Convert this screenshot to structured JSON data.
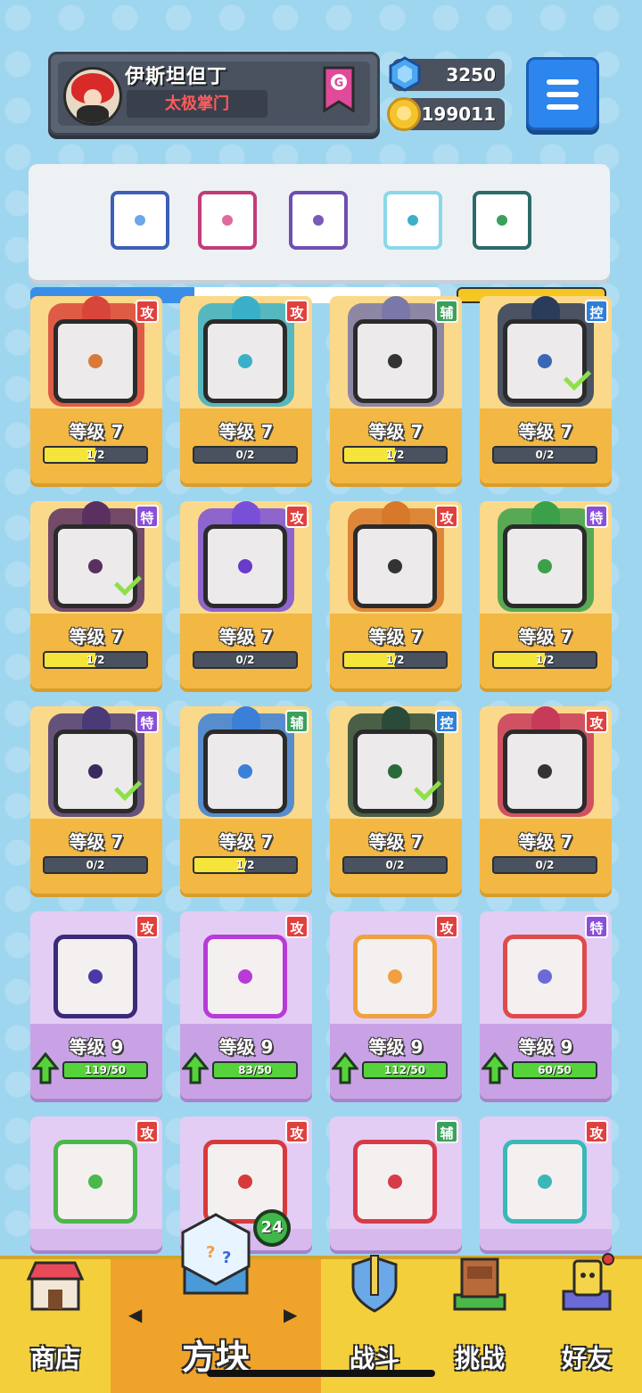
{
  "profile": {
    "name": "伊斯坦但丁",
    "title": "太极掌门",
    "rank_letter": "G"
  },
  "currency": {
    "gems": "3250",
    "coins": "199011"
  },
  "deck": [
    {
      "color": "#3d5fb8",
      "pip": "#6aa8e8"
    },
    {
      "color": "#c23c7a",
      "pip": "#e06a9a"
    },
    {
      "color": "#6e4fb0",
      "pip": "#7a5ab8"
    },
    {
      "color": "#8ad8e8",
      "pip": "#3cb0c8"
    },
    {
      "color": "#2d6a6a",
      "pip": "#3aa05a"
    }
  ],
  "cards": [
    {
      "tag": "攻",
      "tagType": "atk",
      "level": "等级 7",
      "progress": "1/2",
      "fill": 0.5,
      "theme": "#d8453a",
      "pip": "#d87a3a",
      "check": false,
      "kind": "gold"
    },
    {
      "tag": "攻",
      "tagType": "atk",
      "level": "等级 7",
      "progress": "0/2",
      "fill": 0,
      "theme": "#3ab0c8",
      "pip": "#3ab0c8",
      "check": false,
      "kind": "gold"
    },
    {
      "tag": "辅",
      "tagType": "sup",
      "level": "等级 7",
      "progress": "1/2",
      "fill": 0.5,
      "theme": "#7a78a8",
      "pip": "#333333",
      "check": false,
      "kind": "gold"
    },
    {
      "tag": "控",
      "tagType": "ctl",
      "level": "等级 7",
      "progress": "0/2",
      "fill": 0,
      "theme": "#2b3b5a",
      "pip": "#3a66b8",
      "check": true,
      "kind": "gold"
    },
    {
      "tag": "特",
      "tagType": "spc",
      "level": "等级 7",
      "progress": "1/2",
      "fill": 0.5,
      "theme": "#5a3060",
      "pip": "#5a3060",
      "check": true,
      "kind": "gold"
    },
    {
      "tag": "攻",
      "tagType": "atk",
      "level": "等级 7",
      "progress": "0/2",
      "fill": 0,
      "theme": "#7a4fd8",
      "pip": "#6a3ac8",
      "check": false,
      "kind": "gold"
    },
    {
      "tag": "攻",
      "tagType": "atk",
      "level": "等级 7",
      "progress": "1/2",
      "fill": 0.5,
      "theme": "#d8782a",
      "pip": "#333333",
      "check": false,
      "kind": "gold"
    },
    {
      "tag": "特",
      "tagType": "spc",
      "level": "等级 7",
      "progress": "1/2",
      "fill": 0.5,
      "theme": "#3aa04a",
      "pip": "#3aa04a",
      "check": false,
      "kind": "gold"
    },
    {
      "tag": "特",
      "tagType": "spc",
      "level": "等级 7",
      "progress": "0/2",
      "fill": 0,
      "theme": "#4a3a78",
      "pip": "#3a2a60",
      "check": true,
      "kind": "gold"
    },
    {
      "tag": "辅",
      "tagType": "sup",
      "level": "等级 7",
      "progress": "1/2",
      "fill": 0.5,
      "theme": "#3a7fd8",
      "pip": "#3a7fd8",
      "check": false,
      "kind": "gold"
    },
    {
      "tag": "控",
      "tagType": "ctl",
      "level": "等级 7",
      "progress": "0/2",
      "fill": 0,
      "theme": "#2a4a3a",
      "pip": "#2a6a3a",
      "check": true,
      "kind": "gold"
    },
    {
      "tag": "攻",
      "tagType": "atk",
      "level": "等级 7",
      "progress": "0/2",
      "fill": 0,
      "theme": "#c83a5a",
      "pip": "#333333",
      "check": false,
      "kind": "gold"
    },
    {
      "tag": "攻",
      "tagType": "atk",
      "level": "等级 9",
      "progress": "119/50",
      "fill": 1,
      "theme": "#3a2a78",
      "pip": "#4a3aa8",
      "check": false,
      "kind": "purple",
      "up": true
    },
    {
      "tag": "攻",
      "tagType": "atk",
      "level": "等级 9",
      "progress": "83/50",
      "fill": 1,
      "theme": "#b83ad8",
      "pip": "#b83ad8",
      "check": false,
      "kind": "purple",
      "up": true
    },
    {
      "tag": "攻",
      "tagType": "atk",
      "level": "等级 9",
      "progress": "112/50",
      "fill": 1,
      "theme": "#f0a040",
      "pip": "#f0a040",
      "check": false,
      "kind": "purple",
      "up": true
    },
    {
      "tag": "特",
      "tagType": "spc",
      "level": "等级 9",
      "progress": "60/50",
      "fill": 1,
      "theme": "#e04a4a",
      "pip": "#6a6ad8",
      "check": false,
      "kind": "purple",
      "up": true
    },
    {
      "tag": "攻",
      "tagType": "atk",
      "level": "",
      "progress": "",
      "fill": 0,
      "theme": "#4ab84a",
      "pip": "#4ab84a",
      "check": false,
      "kind": "purple"
    },
    {
      "tag": "攻",
      "tagType": "atk",
      "level": "",
      "progress": "",
      "fill": 0,
      "theme": "#d83a3a",
      "pip": "#d83a3a",
      "check": false,
      "kind": "purple"
    },
    {
      "tag": "辅",
      "tagType": "sup",
      "level": "",
      "progress": "",
      "fill": 0,
      "theme": "#d83a4a",
      "pip": "#d83a4a",
      "check": false,
      "kind": "purple"
    },
    {
      "tag": "攻",
      "tagType": "atk",
      "level": "",
      "progress": "",
      "fill": 0,
      "theme": "#3ab8b8",
      "pip": "#3ab8b8",
      "check": false,
      "kind": "purple"
    }
  ],
  "nav": {
    "shop": "商店",
    "dice": "方块",
    "battle": "战斗",
    "challenge": "挑战",
    "friends": "好友",
    "dice_badge": "24"
  }
}
